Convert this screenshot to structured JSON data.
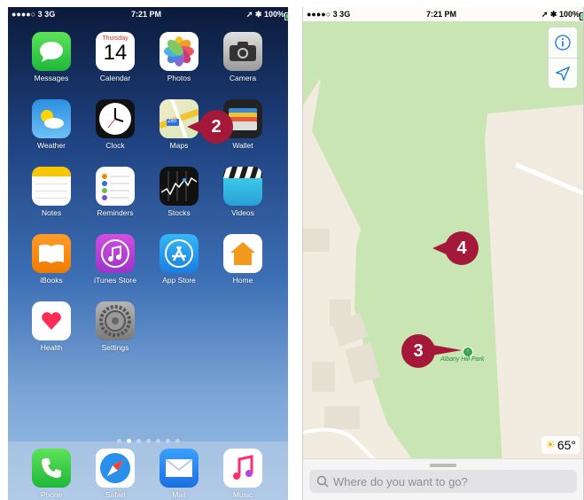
{
  "left_phone": {
    "status": {
      "carrier": "●●●●○ 3  3G",
      "time": "7:21 PM",
      "battery": "100%"
    },
    "apps": [
      {
        "label": "Messages",
        "icon": "messages-icon"
      },
      {
        "label": "Calendar",
        "icon": "calendar-icon",
        "day": "Thursday",
        "date": "14"
      },
      {
        "label": "Photos",
        "icon": "photos-icon"
      },
      {
        "label": "Camera",
        "icon": "camera-icon"
      },
      {
        "label": "Weather",
        "icon": "weather-icon"
      },
      {
        "label": "Clock",
        "icon": "clock-icon"
      },
      {
        "label": "Maps",
        "icon": "maps-icon",
        "sign": "280"
      },
      {
        "label": "Wallet",
        "icon": "wallet-icon"
      },
      {
        "label": "Notes",
        "icon": "notes-icon"
      },
      {
        "label": "Reminders",
        "icon": "reminders-icon"
      },
      {
        "label": "Stocks",
        "icon": "stocks-icon"
      },
      {
        "label": "Videos",
        "icon": "videos-icon"
      },
      {
        "label": "iBooks",
        "icon": "ibooks-icon"
      },
      {
        "label": "iTunes Store",
        "icon": "itunes-store-icon"
      },
      {
        "label": "App Store",
        "icon": "app-store-icon"
      },
      {
        "label": "Home",
        "icon": "home-icon"
      },
      {
        "label": "Health",
        "icon": "health-icon"
      },
      {
        "label": "Settings",
        "icon": "settings-icon"
      }
    ],
    "dock": [
      {
        "label": "Phone",
        "icon": "phone-icon"
      },
      {
        "label": "Safari",
        "icon": "safari-icon"
      },
      {
        "label": "Mail",
        "icon": "mail-icon"
      },
      {
        "label": "Music",
        "icon": "music-icon"
      }
    ],
    "page_dots": {
      "count": 7,
      "active": 1
    },
    "callout": "2"
  },
  "right_phone": {
    "status": {
      "carrier": "●●●●○ 3  3G",
      "time": "7:21 PM",
      "battery": "100%"
    },
    "park_label": "Albany Hill Park",
    "search_placeholder": "Where do you want to go?",
    "weather_temp": "65°",
    "callouts": [
      "4",
      "3"
    ]
  },
  "colors": {
    "callout": "#a4183a",
    "park": "#c9e5b4",
    "map_bg": "#f1ecdf"
  }
}
